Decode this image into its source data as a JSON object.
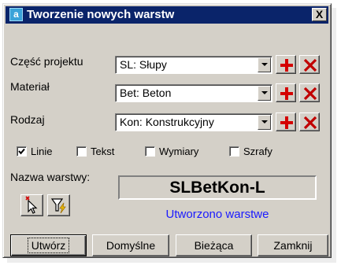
{
  "window": {
    "title": "Tworzenie nowych warstw",
    "close_label": "X"
  },
  "fields": [
    {
      "label": "Część projektu",
      "value": "SL: Słupy"
    },
    {
      "label": "Materiał",
      "value": "Bet: Beton"
    },
    {
      "label": "Rodzaj",
      "value": "Kon: Konstrukcyjny"
    }
  ],
  "options": [
    {
      "label": "Linie",
      "checked": true
    },
    {
      "label": "Tekst",
      "checked": false
    },
    {
      "label": "Wymiary",
      "checked": false
    },
    {
      "label": "Szrafy",
      "checked": false
    }
  ],
  "layer": {
    "name_label": "Nazwa warstwy:",
    "name_value": "SLBetKon-L",
    "status_text": "Utworzono warstwe"
  },
  "buttons": {
    "create": "Utwórz",
    "default": "Domyślne",
    "current": "Bieżąca",
    "close": "Zamknij"
  },
  "colors": {
    "titlebar": "#0a246a",
    "add_icon": "#d40000",
    "delete_icon": "#c00000",
    "status_text": "#1a1aff"
  }
}
